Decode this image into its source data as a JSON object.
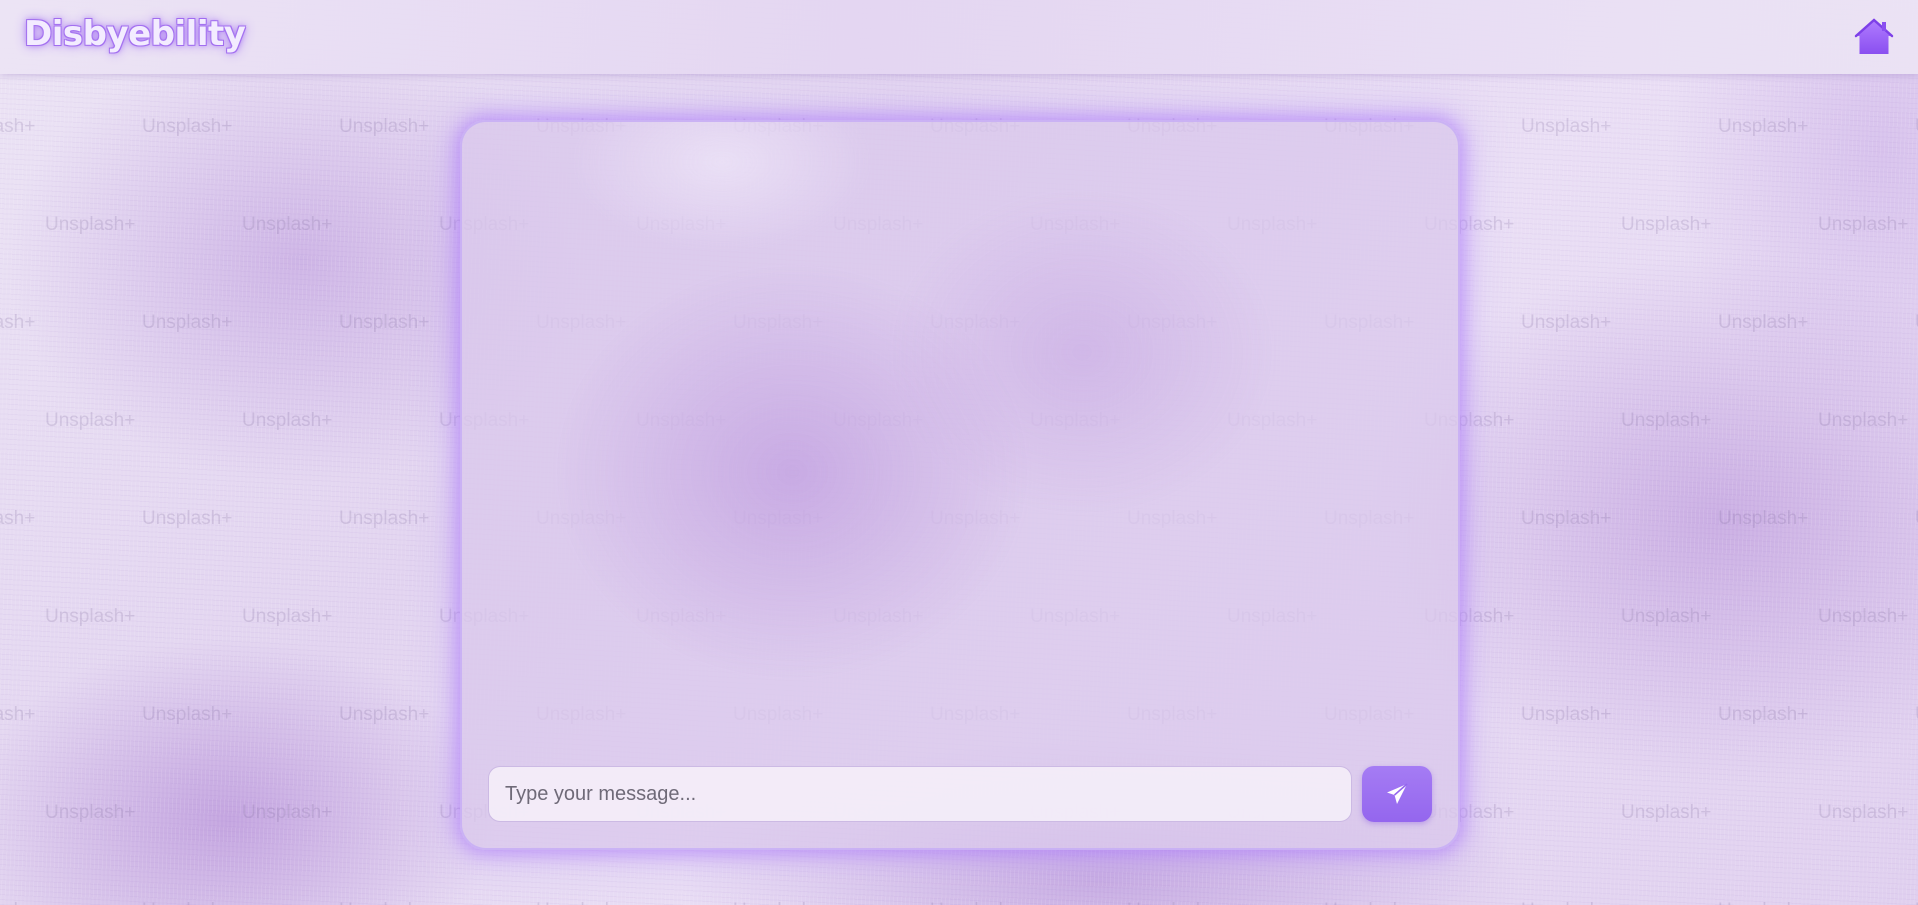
{
  "app": {
    "brand": "Disbyebility"
  },
  "header": {
    "home_icon": "home-icon"
  },
  "background": {
    "watermark_text": "Unsplash+"
  },
  "chat": {
    "input": {
      "value": "",
      "placeholder": "Type your message..."
    },
    "send_icon": "paper-plane-icon"
  },
  "colors": {
    "accent": "#9a63ee",
    "glow": "#a56efa",
    "send_button": "#9466ee"
  }
}
